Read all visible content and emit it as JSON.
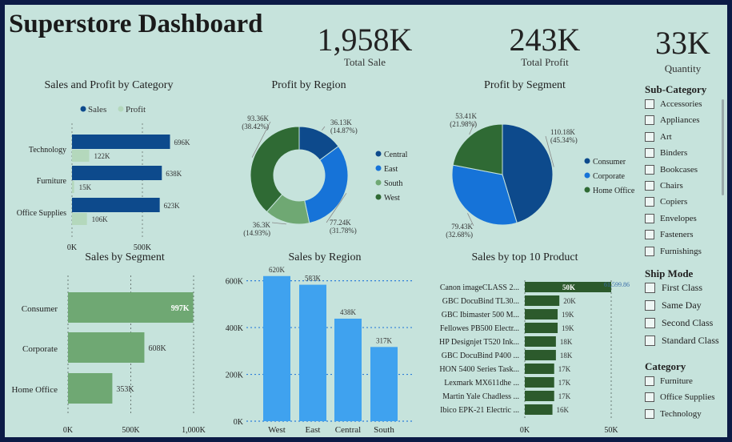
{
  "dashboard": {
    "title": "Superstore Dashboard"
  },
  "kpis": [
    {
      "value": "1,958K",
      "label": "Total Sale"
    },
    {
      "value": "243K",
      "label": "Total Profit"
    },
    {
      "value": "33K",
      "label": "Quantity"
    }
  ],
  "colors": {
    "sales": "#0d4a8c",
    "profit": "#b4d8bc",
    "seg_bar": "#6fa873",
    "region_bar": "#3fa2ef",
    "product_bar": "#2c5a2c"
  },
  "chart_data": [
    {
      "type": "bar",
      "orientation": "horizontal",
      "title": "Sales and Profit by Category",
      "categories": [
        "Technology",
        "Furniture",
        "Office Supplies"
      ],
      "series": [
        {
          "name": "Sales",
          "values": [
            696,
            638,
            623
          ],
          "labels": [
            "696K",
            "638K",
            "623K"
          ]
        },
        {
          "name": "Profit",
          "values": [
            122,
            15,
            106
          ],
          "labels": [
            "122K",
            "15K",
            "106K"
          ]
        }
      ],
      "xlim": [
        0,
        1000
      ],
      "x_ticks": [
        {
          "value": 0,
          "label": "0K"
        },
        {
          "value": 500,
          "label": "500K"
        }
      ],
      "grid": true,
      "legend": "top"
    },
    {
      "type": "pie",
      "donut": true,
      "title": "Profit by Region",
      "slices": [
        {
          "name": "Central",
          "value": 36.13,
          "label": "36.13K",
          "pct": "(14.87%)",
          "color": "#0d4a8c"
        },
        {
          "name": "East",
          "value": 77.24,
          "label": "77.24K",
          "pct": "(31.78%)",
          "color": "#1673d8"
        },
        {
          "name": "South",
          "value": 36.3,
          "label": "36.3K",
          "pct": "(14.93%)",
          "color": "#6fa873"
        },
        {
          "name": "West",
          "value": 93.36,
          "label": "93.36K",
          "pct": "(38.42%)",
          "color": "#2f6a34"
        }
      ],
      "legend": "right"
    },
    {
      "type": "pie",
      "title": "Profit by Segment",
      "slices": [
        {
          "name": "Consumer",
          "value": 110.18,
          "label": "110.18K",
          "pct": "(45.34%)",
          "color": "#0d4a8c"
        },
        {
          "name": "Corporate",
          "value": 79.43,
          "label": "79.43K",
          "pct": "(32.68%)",
          "color": "#1673d8"
        },
        {
          "name": "Home Office",
          "value": 53.41,
          "label": "53.41K",
          "pct": "(21.98%)",
          "color": "#2f6a34"
        }
      ],
      "legend": "right"
    },
    {
      "type": "bar",
      "orientation": "horizontal",
      "title": "Sales by Segment",
      "categories": [
        "Consumer",
        "Corporate",
        "Home Office"
      ],
      "values": [
        997,
        608,
        353
      ],
      "labels": [
        "997K",
        "608K",
        "353K"
      ],
      "xlim": [
        0,
        1000
      ],
      "x_ticks": [
        {
          "value": 0,
          "label": "0K"
        },
        {
          "value": 500,
          "label": "500K"
        },
        {
          "value": 1000,
          "label": "1,000K"
        }
      ],
      "grid": true
    },
    {
      "type": "bar",
      "orientation": "vertical",
      "title": "Sales by Region",
      "categories": [
        "West",
        "East",
        "Central",
        "South"
      ],
      "values": [
        620,
        583,
        438,
        317
      ],
      "labels": [
        "620K",
        "583K",
        "438K",
        "317K"
      ],
      "ylim": [
        0,
        650
      ],
      "y_ticks": [
        {
          "value": 0,
          "label": "0K"
        },
        {
          "value": 200,
          "label": "200K"
        },
        {
          "value": 400,
          "label": "400K"
        },
        {
          "value": 600,
          "label": "600K"
        }
      ],
      "grid": true
    },
    {
      "type": "bar",
      "orientation": "horizontal",
      "title": "Sales by top 10 Product",
      "categories": [
        "Canon imageCLASS 2...",
        "GBC DocuBind TL30...",
        "GBC Ibimaster 500 M...",
        "Fellowes PB500 Electr...",
        "HP Designjet T520 Ink...",
        "GBC DocuBind P400 ...",
        "HON 5400 Series Task...",
        "Lexmark MX611dhe ...",
        "Martin Yale Chadless ...",
        "Ibico EPK-21 Electric ..."
      ],
      "values": [
        61.6,
        20,
        19,
        19,
        18,
        18,
        17,
        17,
        17,
        16
      ],
      "labels": [
        "50K",
        "20K",
        "19K",
        "19K",
        "18K",
        "18K",
        "17K",
        "17K",
        "17K",
        "16K"
      ],
      "reference_line": {
        "value": 50,
        "label": "61,599.86"
      },
      "xlim": [
        0,
        60
      ],
      "x_ticks": [
        {
          "value": 0,
          "label": "0K"
        },
        {
          "value": 50,
          "label": "50K"
        }
      ],
      "grid": true
    }
  ],
  "slicers": {
    "subcategory": {
      "title": "Sub-Category",
      "items": [
        "Accessories",
        "Appliances",
        "Art",
        "Binders",
        "Bookcases",
        "Chairs",
        "Copiers",
        "Envelopes",
        "Fasteners",
        "Furnishings"
      ]
    },
    "shipmode": {
      "title": "Ship Mode",
      "items": [
        "First Class",
        "Same Day",
        "Second Class",
        "Standard Class"
      ]
    },
    "category": {
      "title": "Category",
      "items": [
        "Furniture",
        "Office Supplies",
        "Technology"
      ]
    }
  }
}
